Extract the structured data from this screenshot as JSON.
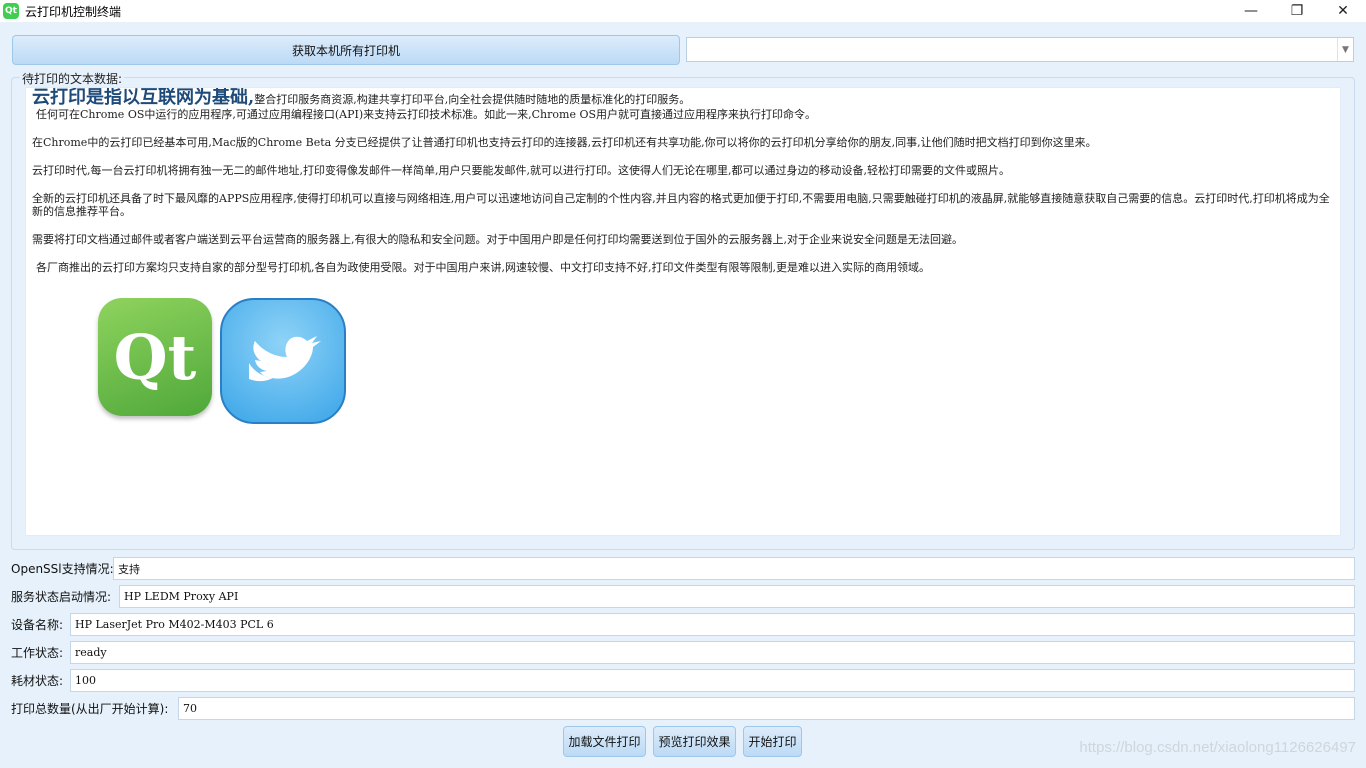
{
  "window": {
    "title": "云打印机控制终端",
    "icon_text": "Qt",
    "controls": {
      "minimize": "—",
      "restore": "❐",
      "close": "✕"
    }
  },
  "toolbar": {
    "get_printers_label": "获取本机所有打印机",
    "printer_combo_value": ""
  },
  "text_group": {
    "title": "待打印的文本数据:",
    "lead_big": "云打印是指以互联网为基础,",
    "lead_rest": "整合打印服务商资源,构建共享打印平台,向全社会提供随时随地的质量标准化的打印服务。",
    "paragraphs": [
      "任何可在Chrome OS中运行的应用程序,可通过应用编程接口(API)来支持云打印技术标准。如此一来,Chrome OS用户就可直接通过应用程序来执行打印命令。",
      "在Chrome中的云打印已经基本可用,Mac版的Chrome Beta 分支已经提供了让普通打印机也支持云打印的连接器,云打印机还有共享功能,你可以将你的云打印机分享给你的朋友,同事,让他们随时把文档打印到你这里来。",
      "云打印时代,每一台云打印机将拥有独一无二的邮件地址,打印变得像发邮件一样简单,用户只要能发邮件,就可以进行打印。这使得人们无论在哪里,都可以通过身边的移动设备,轻松打印需要的文件或照片。",
      "全新的云打印机还具备了时下最风靡的APPS应用程序,使得打印机可以直接与网络相连,用户可以迅速地访问自己定制的个性内容,并且内容的格式更加便于打印,不需要用电脑,只需要触碰打印机的液晶屏,就能够直接随意获取自己需要的信息。云打印时代,打印机将成为全新的信息推荐平台。",
      "需要将打印文档通过邮件或者客户端送到云平台运营商的服务器上,有很大的隐私和安全问题。对于中国用户即是任何打印均需要送到位于国外的云服务器上,对于企业来说安全问题是无法回避。",
      "各厂商推出的云打印方案均只支持自家的部分型号打印机,各自为政使用受限。对于中国用户来讲,网速较慢、中文打印支持不好,打印文件类型有限等限制,更是难以进入实际的商用领域。"
    ],
    "logo_qt_text": "Qt"
  },
  "status": {
    "openssl_label": "OpenSSl支持情况:",
    "openssl_value": "支持",
    "service_label": "服务状态启动情况:",
    "service_value": "HP LEDM Proxy API",
    "device_label": "设备名称:",
    "device_value": "HP LaserJet Pro M402-M403 PCL 6",
    "work_label": "工作状态:",
    "work_value": "ready",
    "consumable_label": "耗材状态:",
    "consumable_value": "100",
    "total_label": "打印总数量(从出厂开始计算):",
    "total_value": "70"
  },
  "actions": {
    "load_file_label": "加载文件打印",
    "preview_label": "预览打印效果",
    "start_label": "开始打印"
  },
  "watermark": "https://blog.csdn.net/xiaolong1126626497"
}
